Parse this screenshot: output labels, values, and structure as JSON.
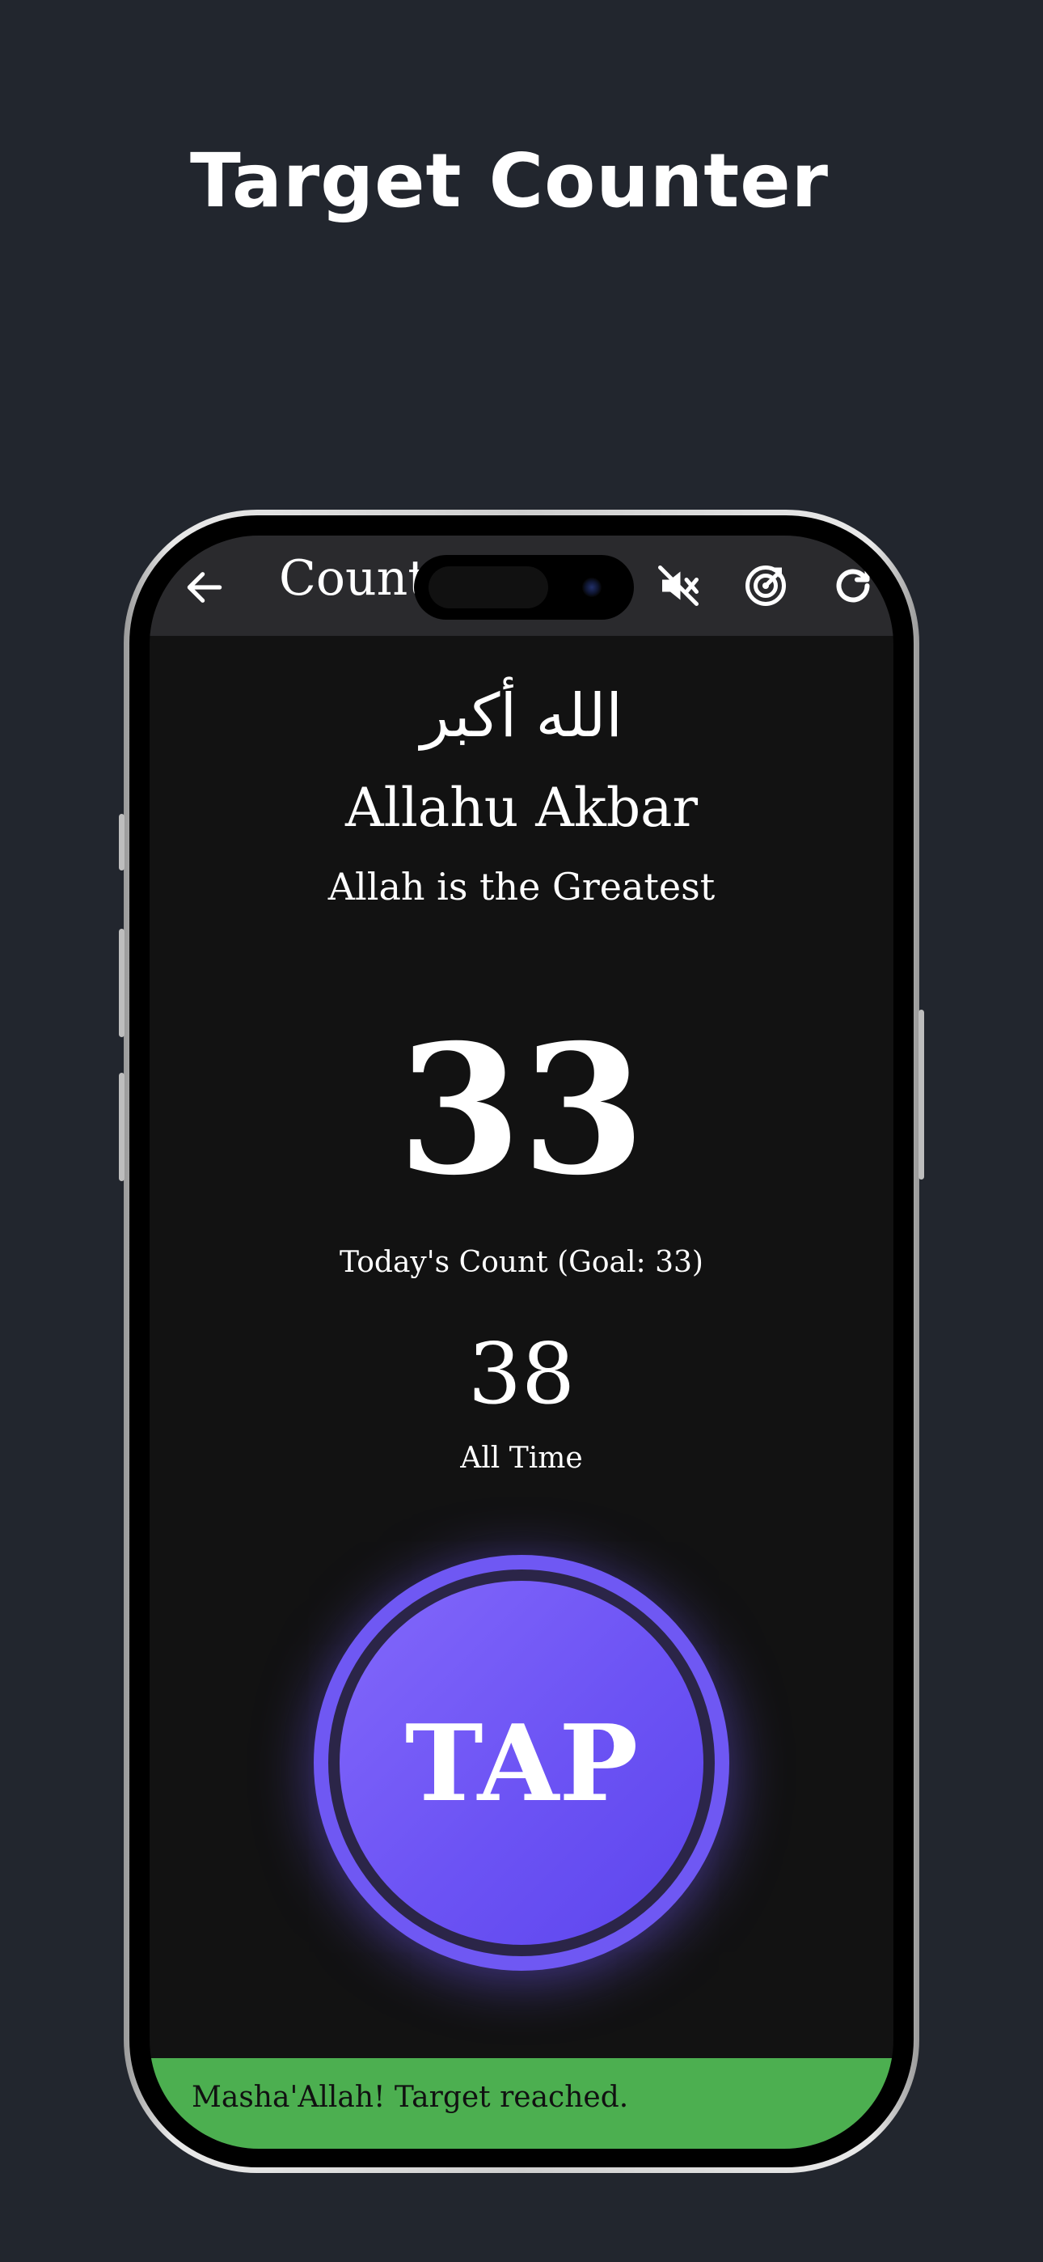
{
  "page": {
    "headline": "Target Counter"
  },
  "appbar": {
    "title": "Counte",
    "back_icon": "arrow-left-icon",
    "sound_icon": "volume-mute-icon",
    "target_icon": "target-icon",
    "reset_icon": "refresh-icon"
  },
  "dhikr": {
    "arabic": "الله أكبر",
    "transliteration": "Allahu Akbar",
    "meaning": "Allah is the Greatest"
  },
  "counter": {
    "today_value": "33",
    "today_label": "Today's Count (Goal: 33)",
    "all_time_value": "38",
    "all_time_label": "All Time"
  },
  "tap_button": {
    "label": "TAP"
  },
  "snackbar": {
    "message": "Masha'Allah! Target reached."
  },
  "colors": {
    "page_background": "#22262e",
    "screen_background": "#121212",
    "appbar_background": "#2a2a2d",
    "accent": "#6f58f3",
    "success": "#4caf50"
  }
}
